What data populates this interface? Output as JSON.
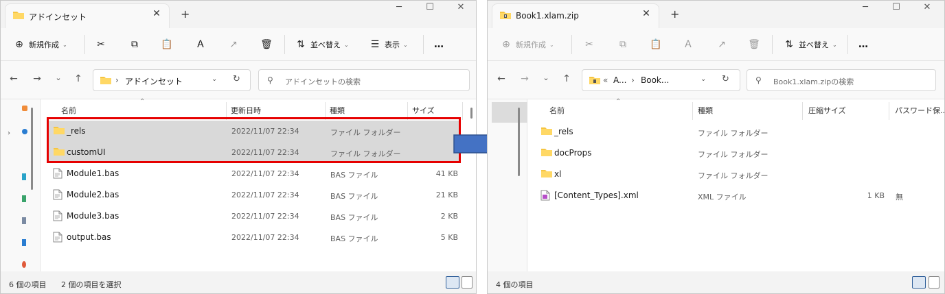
{
  "left": {
    "tab_title": "アドインセット",
    "toolbar": {
      "new_label": "新規作成",
      "sort_label": "並べ替え",
      "view_label": "表示",
      "more_label": "…"
    },
    "address": {
      "sep": "›",
      "path": "アドインセット"
    },
    "search_placeholder": "アドインセットの検索",
    "columns": {
      "name": "名前",
      "modified": "更新日時",
      "type": "種類",
      "size": "サイズ"
    },
    "rows": [
      {
        "name": "_rels",
        "modified": "2022/11/07 22:34",
        "type": "ファイル フォルダー",
        "size": "",
        "kind": "folder",
        "selected": true
      },
      {
        "name": "customUI",
        "modified": "2022/11/07 22:34",
        "type": "ファイル フォルダー",
        "size": "",
        "kind": "folder",
        "selected": true
      },
      {
        "name": "Module1.bas",
        "modified": "2022/11/07 22:34",
        "type": "BAS ファイル",
        "size": "41 KB",
        "kind": "file",
        "selected": false
      },
      {
        "name": "Module2.bas",
        "modified": "2022/11/07 22:34",
        "type": "BAS ファイル",
        "size": "21 KB",
        "kind": "file",
        "selected": false
      },
      {
        "name": "Module3.bas",
        "modified": "2022/11/07 22:34",
        "type": "BAS ファイル",
        "size": "2 KB",
        "kind": "file",
        "selected": false
      },
      {
        "name": "output.bas",
        "modified": "2022/11/07 22:34",
        "type": "BAS ファイル",
        "size": "5 KB",
        "kind": "file",
        "selected": false
      }
    ],
    "status": {
      "count": "6 個の項目",
      "selected": "2 個の項目を選択"
    }
  },
  "right": {
    "tab_title": "Book1.xlam.zip",
    "toolbar": {
      "new_label": "新規作成",
      "sort_label": "並べ替え",
      "more_label": "…"
    },
    "address": {
      "prefix": "«",
      "seg1": "A...",
      "sep": "›",
      "seg2": "Book..."
    },
    "search_placeholder": "Book1.xlam.zipの検索",
    "columns": {
      "name": "名前",
      "type": "種類",
      "compressed": "圧縮サイズ",
      "password": "パスワード保..."
    },
    "rows": [
      {
        "name": "_rels",
        "type": "ファイル フォルダー",
        "compressed": "",
        "password": "",
        "kind": "folder"
      },
      {
        "name": "docProps",
        "type": "ファイル フォルダー",
        "compressed": "",
        "password": "",
        "kind": "folder"
      },
      {
        "name": "xl",
        "type": "ファイル フォルダー",
        "compressed": "",
        "password": "",
        "kind": "folder"
      },
      {
        "name": "[Content_Types].xml",
        "type": "XML ファイル",
        "compressed": "1 KB",
        "password": "無",
        "kind": "xml"
      }
    ],
    "status": {
      "count": "4 個の項目"
    }
  },
  "colors": {
    "highlight": "#e60000",
    "arrow_fill": "#4472c4",
    "arrow_stroke": "#2f528f",
    "folder": "#f5c542",
    "selected_row": "#d9d9d9"
  },
  "icons": [
    "folder-icon",
    "file-icon",
    "xml-file-icon",
    "zip-folder-icon",
    "cut-icon",
    "copy-icon",
    "paste-icon",
    "rename-icon",
    "share-icon",
    "delete-icon",
    "sort-icon",
    "view-icon",
    "more-icon",
    "back-icon",
    "forward-icon",
    "up-icon",
    "refresh-icon",
    "search-icon",
    "close-icon",
    "add-tab-icon",
    "minimize-icon",
    "maximize-icon",
    "window-close-icon",
    "details-view-icon",
    "tiles-view-icon"
  ]
}
